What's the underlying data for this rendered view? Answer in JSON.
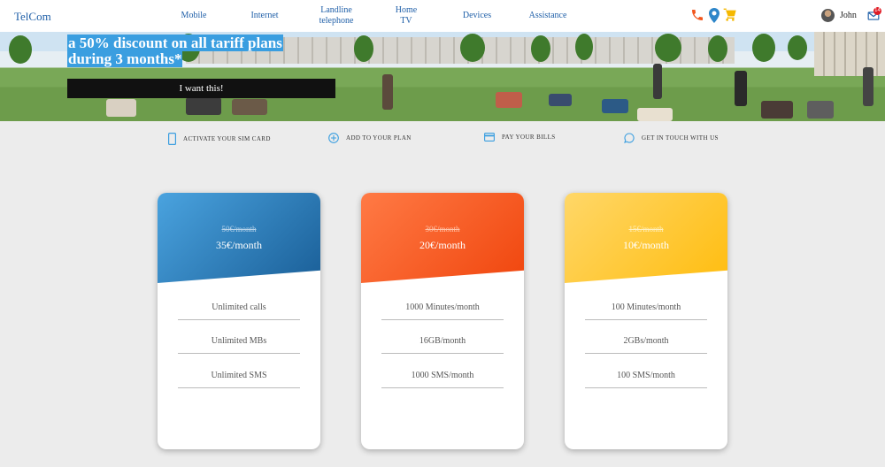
{
  "header": {
    "logo": "TelCom",
    "nav": [
      "Mobile",
      "Internet",
      "Landline telephone",
      "Home TV",
      "Devices",
      "Assistance"
    ],
    "user": "John",
    "notifications": "14"
  },
  "hero": {
    "headline_line1": "a 50% discount on all tariff plans",
    "headline_line2": "during 3 months*",
    "cta": "I want this!"
  },
  "quick_links": [
    "ACTIVATE YOUR SIM CARD",
    "ADD TO YOUR PLAN",
    "PAY YOUR BILLS",
    "GET IN TOUCH WITH US"
  ],
  "plans": [
    {
      "old_price": "50€/month",
      "price": "35€/month",
      "features": [
        "Unlimited calls",
        "Unlimited MBs",
        "Unlimited SMS"
      ],
      "color_from": "#4aa3df",
      "color_to": "#1a5f98"
    },
    {
      "old_price": "30€/month",
      "price": "20€/month",
      "features": [
        "1000 Minutes/month",
        "16GB/month",
        "1000 SMS/month"
      ],
      "color_from": "#ff7a45",
      "color_to": "#f0460e"
    },
    {
      "old_price": "15€/month",
      "price": "10€/month",
      "features": [
        "100 Minutes/month",
        "2GBs/month",
        "100 SMS/month"
      ],
      "color_from": "#ffd768",
      "color_to": "#ffbd10"
    }
  ],
  "colors": {
    "accent": "#1f5fa8",
    "phone": "#f2561d",
    "pin": "#2d86c9",
    "cart": "#f5b800"
  },
  "icons": [
    "phone-icon",
    "location-pin-icon",
    "cart-icon",
    "mail-icon",
    "sim-card-icon",
    "plus-circle-icon",
    "credit-card-icon",
    "chat-icon"
  ]
}
